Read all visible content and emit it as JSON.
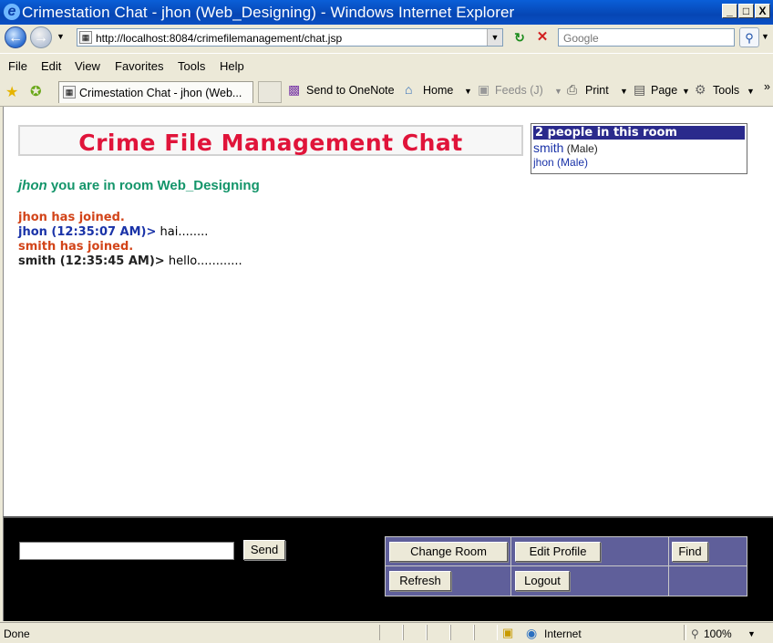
{
  "window": {
    "title": "Crimestation Chat - jhon (Web_Designing) - Windows Internet Explorer",
    "minimize": "_",
    "maximize": "□",
    "close": "X"
  },
  "address_bar": {
    "url": "http://localhost:8084/crimefilemanagement/chat.jsp",
    "search_placeholder": "Google"
  },
  "menu": [
    "File",
    "Edit",
    "View",
    "Favorites",
    "Tools",
    "Help"
  ],
  "tab": {
    "title": "Crimestation Chat - jhon (Web..."
  },
  "toolbar": {
    "send_onenote": "Send to OneNote",
    "home": "Home",
    "feeds": "Feeds (J)",
    "print": "Print",
    "page": "Page",
    "tools": "Tools"
  },
  "chat": {
    "banner_title": "Crime File Management Chat",
    "user": "jhon",
    "room_text": " you are in room Web_Designing",
    "messages": [
      {
        "type": "system",
        "text": "jhon has joined."
      },
      {
        "type": "user",
        "who": "jhon (12:35:07 AM)>",
        "text": " hai........"
      },
      {
        "type": "system",
        "text": "smith has joined."
      },
      {
        "type": "user",
        "who": "smith (12:35:45 AM)>",
        "text": " hello............"
      }
    ]
  },
  "people": {
    "header": "2 people in this room",
    "list": [
      {
        "name": "smith",
        "gender": " (Male)"
      },
      {
        "name": "jhon (Male)"
      }
    ]
  },
  "controls": {
    "message_value": "",
    "send": "Send",
    "change_room": "Change Room",
    "edit_profile": "Edit Profile",
    "find": "Find",
    "refresh": "Refresh",
    "logout": "Logout"
  },
  "status": {
    "text": "Done",
    "zone": "Internet",
    "zoom": "100%"
  },
  "colors": {
    "banner_title": "#e0143a",
    "room_line": "#14956a",
    "system_msg": "#d24419",
    "user_blue": "#1a33a8",
    "people_header_bg": "#2a2a8c",
    "control_table_bg": "#5f5f9a"
  }
}
